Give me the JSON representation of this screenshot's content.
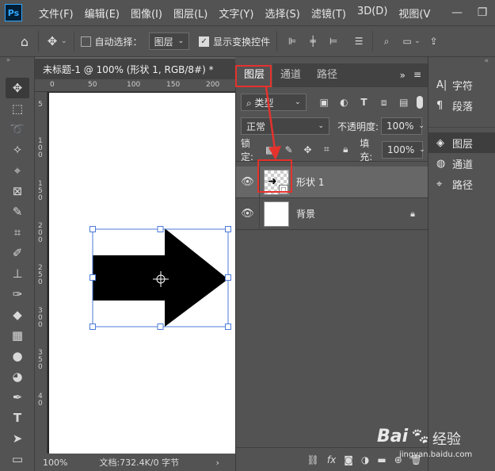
{
  "app": {
    "logo_text": "Ps"
  },
  "menu": [
    "文件(F)",
    "编辑(E)",
    "图像(I)",
    "图层(L)",
    "文字(Y)",
    "选择(S)",
    "滤镜(T)",
    "3D(D)",
    "视图(V"
  ],
  "options": {
    "auto_select_label": "自动选择：",
    "auto_select_target": "图层",
    "show_transform_label": "显示变换控件"
  },
  "document": {
    "tab_title": "未标题-1 @ 100% (形状 1, RGB/8#) *",
    "ruler_top": [
      "0",
      "50",
      "100",
      "150",
      "200"
    ],
    "ruler_left": [
      "5",
      "1 0 0",
      "1 5 0",
      "2 0 0",
      "2 5 0",
      "3 0 0",
      "3 5 0",
      "4 0"
    ],
    "zoom": "100%",
    "doc_info": "文档:732.4K/0 字节"
  },
  "layers_panel": {
    "tabs": [
      "图层",
      "通道",
      "路径"
    ],
    "filter_kind": "类型",
    "blend_mode": "正常",
    "opacity_label": "不透明度:",
    "opacity_value": "100%",
    "lock_label": "锁定:",
    "fill_label": "填充:",
    "fill_value": "100%",
    "layers": [
      {
        "name": "形状 1",
        "selected": true
      },
      {
        "name": "背景",
        "selected": false
      }
    ]
  },
  "right_dock": {
    "group1": [
      {
        "icon": "A|",
        "label": "字符"
      },
      {
        "icon": "¶",
        "label": "段落"
      }
    ],
    "group2": [
      {
        "icon": "◈",
        "label": "图层"
      },
      {
        "icon": "◍",
        "label": "通道"
      },
      {
        "icon": "⌖",
        "label": "路径"
      }
    ]
  },
  "watermark": {
    "brand": "Bai",
    "brand2": "经验",
    "url": "jingyan.baidu.com"
  },
  "colors": {
    "highlight_red": "#e5322d",
    "ps_blue": "#31a8ff"
  }
}
